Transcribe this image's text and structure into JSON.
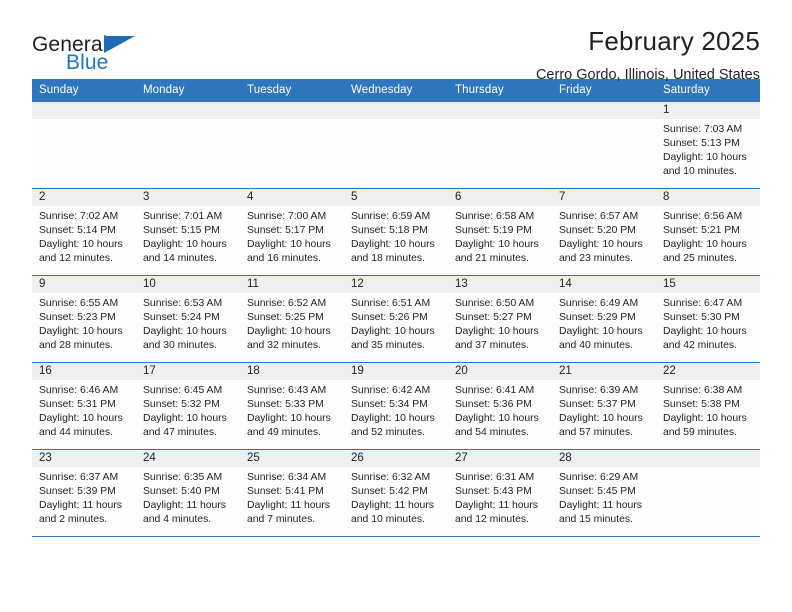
{
  "brand": {
    "line1": "General",
    "line2": "Blue",
    "triangle_color": "#1f6cb4",
    "blue_text_color": "#1f74c0"
  },
  "header": {
    "title": "February 2025",
    "subtitle": "Cerro Gordo, Illinois, United States"
  },
  "colors": {
    "header_band": "#2f76bc",
    "daynum_band": "#efefef",
    "cell_background": "#fdfdfd",
    "text": "#231f20"
  },
  "weekday_headers": [
    "Sunday",
    "Monday",
    "Tuesday",
    "Wednesday",
    "Thursday",
    "Friday",
    "Saturday"
  ],
  "weeks": [
    [
      {
        "day": "",
        "sunrise": "",
        "sunset": "",
        "daylight": ""
      },
      {
        "day": "",
        "sunrise": "",
        "sunset": "",
        "daylight": ""
      },
      {
        "day": "",
        "sunrise": "",
        "sunset": "",
        "daylight": ""
      },
      {
        "day": "",
        "sunrise": "",
        "sunset": "",
        "daylight": ""
      },
      {
        "day": "",
        "sunrise": "",
        "sunset": "",
        "daylight": ""
      },
      {
        "day": "",
        "sunrise": "",
        "sunset": "",
        "daylight": ""
      },
      {
        "day": "1",
        "sunrise": "Sunrise: 7:03 AM",
        "sunset": "Sunset: 5:13 PM",
        "daylight": "Daylight: 10 hours and 10 minutes."
      }
    ],
    [
      {
        "day": "2",
        "sunrise": "Sunrise: 7:02 AM",
        "sunset": "Sunset: 5:14 PM",
        "daylight": "Daylight: 10 hours and 12 minutes."
      },
      {
        "day": "3",
        "sunrise": "Sunrise: 7:01 AM",
        "sunset": "Sunset: 5:15 PM",
        "daylight": "Daylight: 10 hours and 14 minutes."
      },
      {
        "day": "4",
        "sunrise": "Sunrise: 7:00 AM",
        "sunset": "Sunset: 5:17 PM",
        "daylight": "Daylight: 10 hours and 16 minutes."
      },
      {
        "day": "5",
        "sunrise": "Sunrise: 6:59 AM",
        "sunset": "Sunset: 5:18 PM",
        "daylight": "Daylight: 10 hours and 18 minutes."
      },
      {
        "day": "6",
        "sunrise": "Sunrise: 6:58 AM",
        "sunset": "Sunset: 5:19 PM",
        "daylight": "Daylight: 10 hours and 21 minutes."
      },
      {
        "day": "7",
        "sunrise": "Sunrise: 6:57 AM",
        "sunset": "Sunset: 5:20 PM",
        "daylight": "Daylight: 10 hours and 23 minutes."
      },
      {
        "day": "8",
        "sunrise": "Sunrise: 6:56 AM",
        "sunset": "Sunset: 5:21 PM",
        "daylight": "Daylight: 10 hours and 25 minutes."
      }
    ],
    [
      {
        "day": "9",
        "sunrise": "Sunrise: 6:55 AM",
        "sunset": "Sunset: 5:23 PM",
        "daylight": "Daylight: 10 hours and 28 minutes."
      },
      {
        "day": "10",
        "sunrise": "Sunrise: 6:53 AM",
        "sunset": "Sunset: 5:24 PM",
        "daylight": "Daylight: 10 hours and 30 minutes."
      },
      {
        "day": "11",
        "sunrise": "Sunrise: 6:52 AM",
        "sunset": "Sunset: 5:25 PM",
        "daylight": "Daylight: 10 hours and 32 minutes."
      },
      {
        "day": "12",
        "sunrise": "Sunrise: 6:51 AM",
        "sunset": "Sunset: 5:26 PM",
        "daylight": "Daylight: 10 hours and 35 minutes."
      },
      {
        "day": "13",
        "sunrise": "Sunrise: 6:50 AM",
        "sunset": "Sunset: 5:27 PM",
        "daylight": "Daylight: 10 hours and 37 minutes."
      },
      {
        "day": "14",
        "sunrise": "Sunrise: 6:49 AM",
        "sunset": "Sunset: 5:29 PM",
        "daylight": "Daylight: 10 hours and 40 minutes."
      },
      {
        "day": "15",
        "sunrise": "Sunrise: 6:47 AM",
        "sunset": "Sunset: 5:30 PM",
        "daylight": "Daylight: 10 hours and 42 minutes."
      }
    ],
    [
      {
        "day": "16",
        "sunrise": "Sunrise: 6:46 AM",
        "sunset": "Sunset: 5:31 PM",
        "daylight": "Daylight: 10 hours and 44 minutes."
      },
      {
        "day": "17",
        "sunrise": "Sunrise: 6:45 AM",
        "sunset": "Sunset: 5:32 PM",
        "daylight": "Daylight: 10 hours and 47 minutes."
      },
      {
        "day": "18",
        "sunrise": "Sunrise: 6:43 AM",
        "sunset": "Sunset: 5:33 PM",
        "daylight": "Daylight: 10 hours and 49 minutes."
      },
      {
        "day": "19",
        "sunrise": "Sunrise: 6:42 AM",
        "sunset": "Sunset: 5:34 PM",
        "daylight": "Daylight: 10 hours and 52 minutes."
      },
      {
        "day": "20",
        "sunrise": "Sunrise: 6:41 AM",
        "sunset": "Sunset: 5:36 PM",
        "daylight": "Daylight: 10 hours and 54 minutes."
      },
      {
        "day": "21",
        "sunrise": "Sunrise: 6:39 AM",
        "sunset": "Sunset: 5:37 PM",
        "daylight": "Daylight: 10 hours and 57 minutes."
      },
      {
        "day": "22",
        "sunrise": "Sunrise: 6:38 AM",
        "sunset": "Sunset: 5:38 PM",
        "daylight": "Daylight: 10 hours and 59 minutes."
      }
    ],
    [
      {
        "day": "23",
        "sunrise": "Sunrise: 6:37 AM",
        "sunset": "Sunset: 5:39 PM",
        "daylight": "Daylight: 11 hours and 2 minutes."
      },
      {
        "day": "24",
        "sunrise": "Sunrise: 6:35 AM",
        "sunset": "Sunset: 5:40 PM",
        "daylight": "Daylight: 11 hours and 4 minutes."
      },
      {
        "day": "25",
        "sunrise": "Sunrise: 6:34 AM",
        "sunset": "Sunset: 5:41 PM",
        "daylight": "Daylight: 11 hours and 7 minutes."
      },
      {
        "day": "26",
        "sunrise": "Sunrise: 6:32 AM",
        "sunset": "Sunset: 5:42 PM",
        "daylight": "Daylight: 11 hours and 10 minutes."
      },
      {
        "day": "27",
        "sunrise": "Sunrise: 6:31 AM",
        "sunset": "Sunset: 5:43 PM",
        "daylight": "Daylight: 11 hours and 12 minutes."
      },
      {
        "day": "28",
        "sunrise": "Sunrise: 6:29 AM",
        "sunset": "Sunset: 5:45 PM",
        "daylight": "Daylight: 11 hours and 15 minutes."
      },
      {
        "day": "",
        "sunrise": "",
        "sunset": "",
        "daylight": ""
      }
    ]
  ]
}
